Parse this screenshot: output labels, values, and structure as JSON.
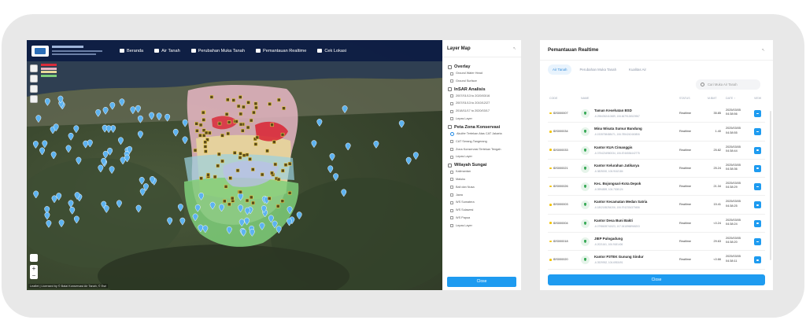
{
  "nav": {
    "items": [
      {
        "label": "Beranda",
        "icon": "home-icon"
      },
      {
        "label": "Air Tanah",
        "icon": "water-icon"
      },
      {
        "label": "Perubahan Muka Tanah",
        "icon": "layers-icon"
      },
      {
        "label": "Pemantauan Realtime",
        "icon": "signal-icon"
      },
      {
        "label": "Cek Lokasi",
        "icon": "location-icon"
      }
    ]
  },
  "map": {
    "attribution": "Leaflet | Licensed by © Balai Konservasi Air Tanah, © Esri",
    "zoom_in": "+",
    "zoom_out": "−"
  },
  "layer_panel": {
    "title": "Layer Map",
    "close_label": "Close",
    "sections": [
      {
        "title": "Overlay",
        "items": [
          "Ground Water Head",
          "Ground Surface"
        ]
      },
      {
        "title": "InSAR Analisis",
        "items": [
          "2007/01/13 to 2020/03/16",
          "2007/01/13 to 2010/12/27",
          "2018/11/17 to 2020/03/17",
          "Lepas Layer"
        ]
      },
      {
        "title": "Peta Zona Konservasi",
        "items": [
          "Akuifer Tertekan Atas CAT Jakarta",
          "CAT Serang-Tangerang",
          "Zona Konservasi Tertekan Tengah",
          "Lepas Layer"
        ]
      },
      {
        "title": "Wilayah Sungai",
        "items": [
          "Kalimantan",
          "Maluku",
          "Bali dan Nusa",
          "Jawa",
          "WS Sumatera",
          "WS Sulawesi",
          "WS Papua",
          "Lepas Layer"
        ]
      }
    ]
  },
  "realtime": {
    "title": "Pemantauan Realtime",
    "tabs": [
      "Air Tanah",
      "Perubahan Muka Tanah",
      "Kualitas Air"
    ],
    "active_tab": 0,
    "search_placeholder": "Cari Muka Air Tanah",
    "columns": [
      "CODE",
      "NAME",
      "STATUS",
      "M.BMT",
      "DATE ↑",
      "VIEW"
    ],
    "close_label": "Close",
    "rows": [
      {
        "code": "IDS000007",
        "name": "Taman Kesehatan BSD",
        "coord": "-6.2984352410689, 106.6679126520967",
        "status": "Realtime",
        "level": "35.85",
        "date": "2025/03/05",
        "time": "04:38:56"
      },
      {
        "code": "IDS000034",
        "name": "Mina Wisata Sumur Bandung",
        "coord": "-6.1928758488471, 106.7854242460806",
        "status": "Realtime",
        "level": "1.40",
        "date": "2025/03/05",
        "time": "04:38:55"
      },
      {
        "code": "IDS000033",
        "name": "Kantor KUA Cimanggis",
        "coord": "-6.3754234980034, 106.8746536442775",
        "status": "Realtime",
        "level": "25.82",
        "date": "2025/03/05",
        "time": "04:38:44"
      },
      {
        "code": "IDS000021",
        "name": "Kantor Kelurahan Jatikarya",
        "coord": "-6.3825000, 106.9162184",
        "status": "Realtime",
        "level": "25.24",
        "date": "2025/03/05",
        "time": "04:38:36"
      },
      {
        "code": "IDS000026",
        "name": "Kec. Bojongsari-Kota Depok",
        "coord": "-6.3994859, 106.7308124",
        "status": "Realtime",
        "level": "21.34",
        "date": "2025/03/05",
        "time": "04:38:29"
      },
      {
        "code": "IDS000003",
        "name": "Kantor Kecamatan Medan Satria",
        "coord": "-6.1802185254206, 106.9742334379456",
        "status": "Realtime",
        "level": "15.41",
        "date": "2025/03/05",
        "time": "04:38:25"
      },
      {
        "code": "IDS000004",
        "name": "Kantor Desa Buni Bakti",
        "coord": "-6.0798639741523, 107.0618968968203",
        "status": "Realtime",
        "level": "<0.24",
        "date": "2025/03/05",
        "time": "04:38:24"
      },
      {
        "code": "IDS000018",
        "name": "JIEP Pulogadung",
        "coord": "-6.2021161, 106.9181406",
        "status": "Realtime",
        "level": "29.63",
        "date": "2025/03/05",
        "time": "04:38:20"
      },
      {
        "code": "IDS000020",
        "name": "Kantor P3TEK Gunung Sindur",
        "coord": "-6.3929952, 106.6953491",
        "status": "Realtime",
        "level": "<0.66",
        "date": "2025/03/05",
        "time": "04:38:11"
      }
    ]
  }
}
